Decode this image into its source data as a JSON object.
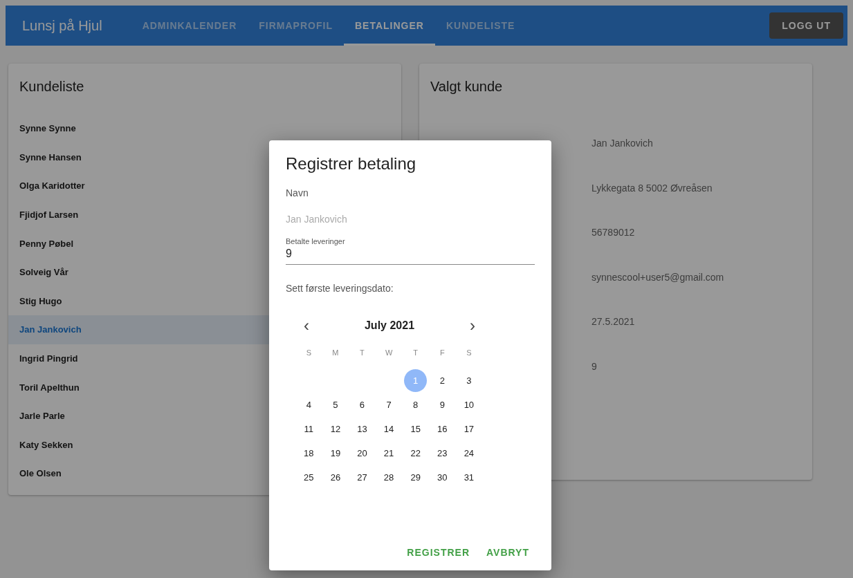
{
  "app_bar": {
    "title": "Lunsj på Hjul",
    "tabs": [
      {
        "label": "ADMINKALENDER",
        "selected": false
      },
      {
        "label": "FIRMAPROFIL",
        "selected": false
      },
      {
        "label": "BETALINGER",
        "selected": true
      },
      {
        "label": "KUNDELISTE",
        "selected": false
      }
    ],
    "logout": "LOGG UT"
  },
  "customer_list": {
    "title": "Kundeliste",
    "items": [
      {
        "name": "Synne Synne",
        "selected": false
      },
      {
        "name": "Synne Hansen",
        "selected": false
      },
      {
        "name": "Olga Karidotter",
        "selected": false
      },
      {
        "name": "Fjidjof Larsen",
        "selected": false
      },
      {
        "name": "Penny Pøbel",
        "selected": false
      },
      {
        "name": "Solveig Vår",
        "selected": false
      },
      {
        "name": "Stig Hugo",
        "selected": false
      },
      {
        "name": "Jan Jankovich",
        "selected": true
      },
      {
        "name": "Ingrid Pingrid",
        "selected": false
      },
      {
        "name": "Toril Apelthun",
        "selected": false
      },
      {
        "name": "Jarle Parle",
        "selected": false
      },
      {
        "name": "Katy Sekken",
        "selected": false
      },
      {
        "name": "Ole Olsen",
        "selected": false
      }
    ]
  },
  "selected_customer": {
    "title": "Valgt kunde",
    "values": [
      "Jan Jankovich",
      "Lykkegata 8 5002 Øvreåsen",
      "56789012",
      "synnescool+user5@gmail.com",
      "27.5.2021",
      "9"
    ]
  },
  "dialog": {
    "title": "Registrer betaling",
    "name_label": "Navn",
    "name_value": "Jan Jankovich",
    "paid_field": {
      "label": "Betalte leveringer",
      "value": "9"
    },
    "date_label": "Sett første leveringsdato:",
    "calendar": {
      "month": "July 2021",
      "prev": "‹",
      "next": "›",
      "weekdays": [
        "S",
        "M",
        "T",
        "W",
        "T",
        "F",
        "S"
      ],
      "weeks": [
        [
          {
            "day": "1",
            "selected": true
          },
          {
            "day": "2",
            "selected": false
          },
          {
            "day": "3",
            "selected": false
          }
        ],
        [
          {
            "day": "4",
            "selected": false
          },
          {
            "day": "5",
            "selected": false
          },
          {
            "day": "6",
            "selected": false
          },
          {
            "day": "7",
            "selected": false
          },
          {
            "day": "8",
            "selected": false
          },
          {
            "day": "9",
            "selected": false
          },
          {
            "day": "10",
            "selected": false
          }
        ],
        [
          {
            "day": "11",
            "selected": false
          },
          {
            "day": "12",
            "selected": false
          },
          {
            "day": "13",
            "selected": false
          },
          {
            "day": "14",
            "selected": false
          },
          {
            "day": "15",
            "selected": false
          },
          {
            "day": "16",
            "selected": false
          },
          {
            "day": "17",
            "selected": false
          }
        ],
        [
          {
            "day": "18",
            "selected": false
          },
          {
            "day": "19",
            "selected": false
          },
          {
            "day": "20",
            "selected": false
          },
          {
            "day": "21",
            "selected": false
          },
          {
            "day": "22",
            "selected": false
          },
          {
            "day": "23",
            "selected": false
          },
          {
            "day": "24",
            "selected": false
          }
        ],
        [
          {
            "day": "25",
            "selected": false
          },
          {
            "day": "26",
            "selected": false
          },
          {
            "day": "27",
            "selected": false
          },
          {
            "day": "28",
            "selected": false
          },
          {
            "day": "29",
            "selected": false
          },
          {
            "day": "30",
            "selected": false
          },
          {
            "day": "31",
            "selected": false
          }
        ]
      ]
    },
    "buttons": [
      "REGISTRER",
      "AVBRYT"
    ]
  }
}
